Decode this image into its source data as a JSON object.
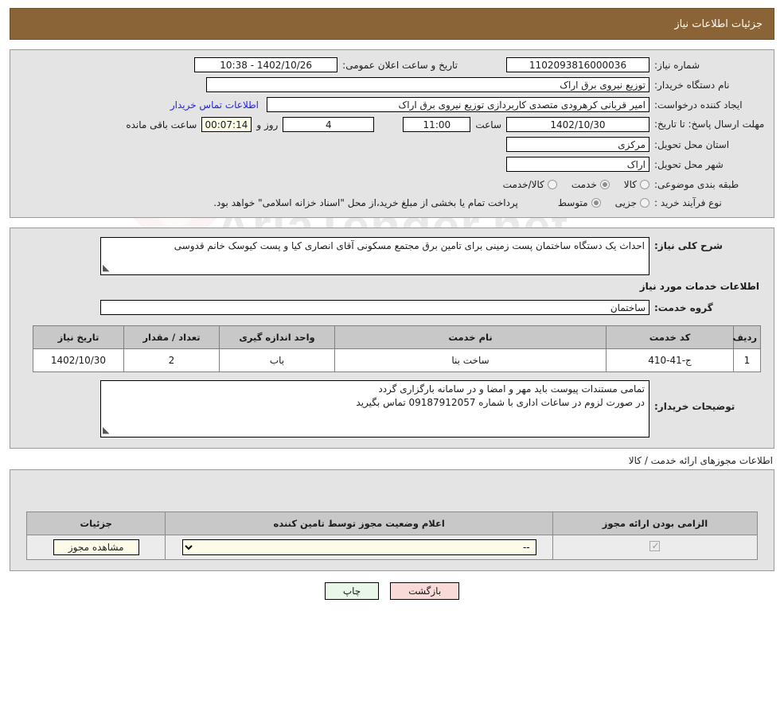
{
  "header": {
    "title": "جزئیات اطلاعات نیاز"
  },
  "summary": {
    "need_number_label": "شماره نیاز:",
    "need_number_value": "1102093816000036",
    "announce_label": "تاریخ و ساعت اعلان عمومی:",
    "announce_value": "1402/10/26 - 10:38",
    "buyer_org_label": "نام دستگاه خریدار:",
    "buyer_org_value": "توزیع نیروی برق اراک",
    "creator_label": "ایجاد کننده درخواست:",
    "creator_value": "امیر قربانی کرهرودی متصدی کاربردازی توزیع نیروی برق اراک",
    "contact_link": "اطلاعات تماس خریدار",
    "deadline_label": "مهلت ارسال پاسخ: تا تاریخ:",
    "deadline_date": "1402/10/30",
    "deadline_hour_label": "ساعت",
    "deadline_hour": "11:00",
    "days_left": "4",
    "days_word": "روز و",
    "timer": "00:07:14",
    "timer_suffix": "ساعت باقی مانده",
    "province_label": "استان محل تحویل:",
    "province_value": "مرکزی",
    "city_label": "شهر محل تحویل:",
    "city_value": "اراک",
    "category_label": "طبقه بندی موضوعی:",
    "category_options": [
      {
        "label": "کالا",
        "selected": false
      },
      {
        "label": "خدمت",
        "selected": true
      },
      {
        "label": "کالا/خدمت",
        "selected": false
      }
    ],
    "process_label": "نوع فرآیند خرید :",
    "process_options": [
      {
        "label": "جزیی",
        "selected": false
      },
      {
        "label": "متوسط",
        "selected": true
      }
    ],
    "process_note": "پرداخت تمام یا بخشی از مبلغ خرید،از محل \"اسناد خزانه اسلامی\" خواهد بود."
  },
  "details": {
    "overview_label": "شرح کلی نیاز:",
    "overview_text": "احداث یک دستگاه ساختمان پست زمینی برای تامین برق مجتمع مسکونی آقای انصاری کیا و پست کیوسک خانم قدوسی",
    "services_section_title": "اطلاعات خدمات مورد نیاز",
    "service_group_label": "گروه خدمت:",
    "service_group_value": "ساختمان",
    "table": {
      "columns": [
        "ردیف",
        "کد خدمت",
        "نام خدمت",
        "واحد اندازه گیری",
        "تعداد / مقدار",
        "تاریخ نیاز"
      ],
      "rows": [
        {
          "row": "1",
          "code": "ج-41-410",
          "name": "ساخت بنا",
          "unit": "باب",
          "qty": "2",
          "date": "1402/10/30"
        }
      ]
    },
    "buyer_notes_label": "توضیحات خریدار:",
    "buyer_notes_line1": "تمامی مستندات پیوست باید مهر و امضا و در سامانه بارگزاری گردد",
    "buyer_notes_line2": "در صورت لزوم در ساعات اداری با شماره 09187912057 تماس بگیرید"
  },
  "permits": {
    "section_label": "اطلاعات مجوزهای ارائه خدمت / کالا",
    "columns": [
      "الزامی بودن ارائه مجوز",
      "اعلام وضعیت مجوز توسط تامین کننده",
      "جزئیات"
    ],
    "rows": [
      {
        "required": true,
        "status_value": "--",
        "status_options": [
          "--"
        ],
        "details_button": "مشاهده مجوز"
      }
    ]
  },
  "footer": {
    "print_label": "چاپ",
    "back_label": "بازگشت"
  },
  "watermark": {
    "text": "AriaTender.net"
  },
  "colors": {
    "header_bar": "#8a6437",
    "link": "#2020ee",
    "panel_bg": "#e4e4e4",
    "table_header": "#c8c8c8",
    "print_btn": "#e9f7e9",
    "back_btn": "#fad9d9",
    "beige_field": "#fbfbe8"
  }
}
